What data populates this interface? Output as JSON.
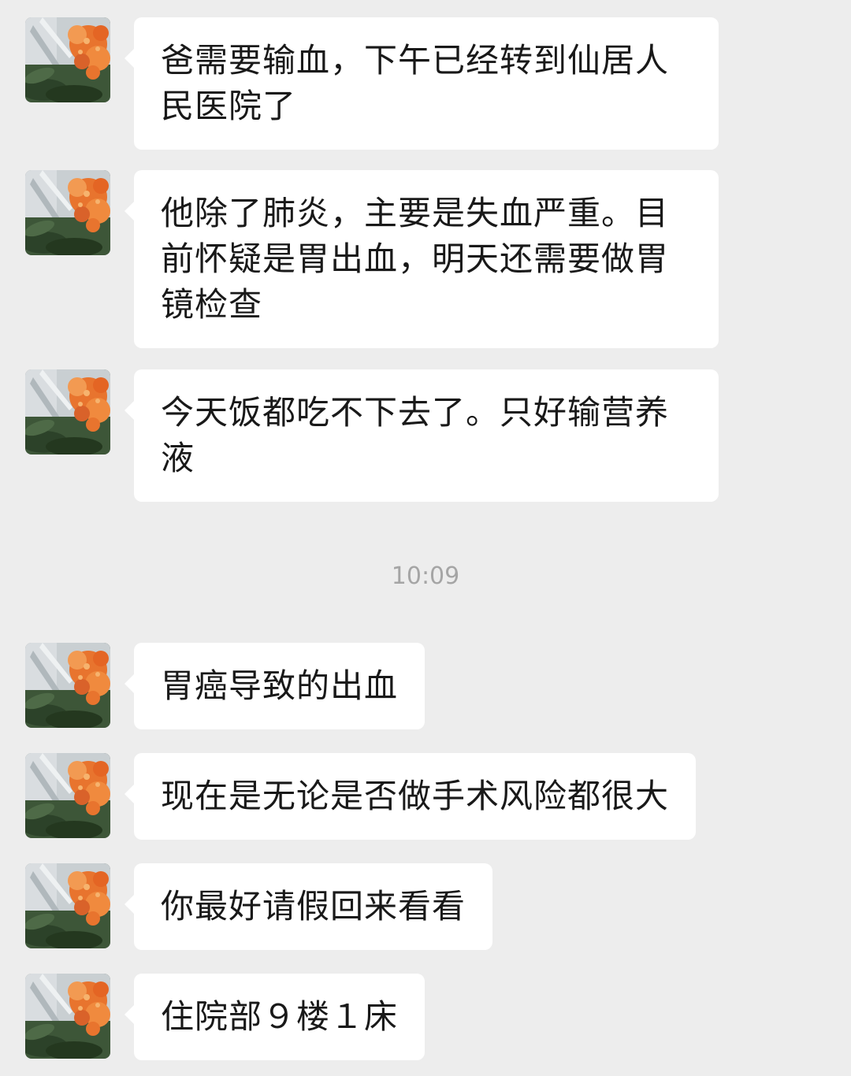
{
  "conversation": {
    "messages_before": [
      {
        "text": "爸需要输血，下午已经转到仙居人民医院了"
      },
      {
        "text": "他除了肺炎，主要是失血严重。目前怀疑是胃出血，明天还需要做胃镜检查"
      },
      {
        "text": "今天饭都吃不下去了。只好输营养液"
      }
    ],
    "timestamp": "10:09",
    "messages_after": [
      {
        "text": "胃癌导致的出血"
      },
      {
        "text": "现在是无论是否做手术风险都很大"
      },
      {
        "text": "你最好请假回来看看"
      },
      {
        "text": "住院部９楼１床"
      }
    ]
  },
  "avatar": {
    "icon": "flower-photo-avatar",
    "colors": {
      "flower": "#e8742e",
      "leaf": "#2f4a2c",
      "sky": "#c9cfd2"
    }
  },
  "colors": {
    "background": "#ededed",
    "bubble": "#ffffff",
    "text": "#191919",
    "timestamp": "#a5a5a5"
  }
}
